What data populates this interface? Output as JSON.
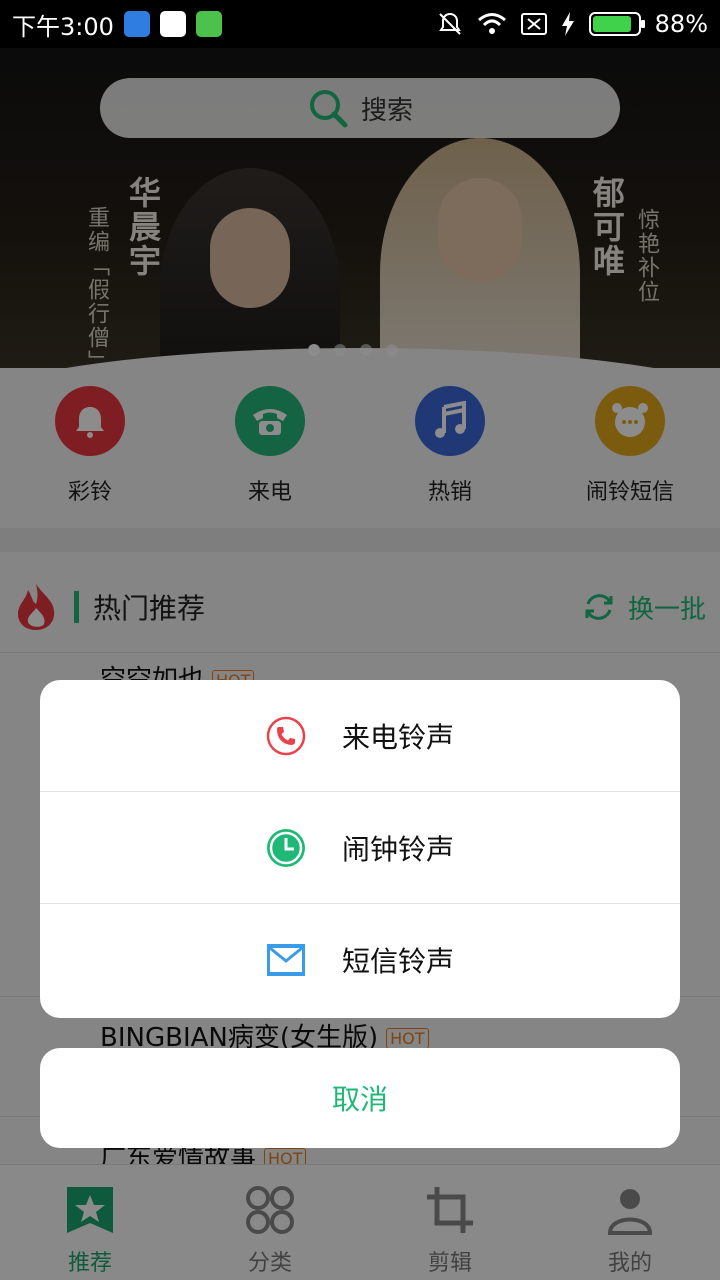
{
  "status_bar": {
    "time": "下午3:00",
    "battery": "88%",
    "battery_level": 0.88
  },
  "search": {
    "placeholder": "搜索"
  },
  "banner": {
    "artist_left": "华晨宇",
    "subtitle_left": "重编「假行僧」",
    "artist_right": "郁可唯",
    "subtitle_right": "惊艳补位",
    "active_dot": 1
  },
  "quick_actions": [
    {
      "label": "彩铃",
      "color": "#e8383f",
      "icon": "bell-icon"
    },
    {
      "label": "来电",
      "color": "#26b57a",
      "icon": "phone-icon"
    },
    {
      "label": "热销",
      "color": "#3b68d8",
      "icon": "music-note-icon"
    },
    {
      "label": "闹铃短信",
      "color": "#e0a81a",
      "icon": "alarm-chat-icon"
    }
  ],
  "section": {
    "title": "热门推荐",
    "refresh": "换一批"
  },
  "songs": [
    {
      "name": "空空如也",
      "badge": "HOT"
    },
    {
      "name": "BINGBIAN病变(女生版)",
      "badge": "HOT"
    },
    {
      "name": "广东爱情故事",
      "badge": "HOT"
    }
  ],
  "tabs": [
    {
      "label": "推荐",
      "active": true
    },
    {
      "label": "分类",
      "active": false
    },
    {
      "label": "剪辑",
      "active": false
    },
    {
      "label": "我的",
      "active": false
    }
  ],
  "sheet": {
    "options": [
      {
        "label": "来电铃声",
        "icon": "phone-ring-icon",
        "color": "#e8434b"
      },
      {
        "label": "闹钟铃声",
        "icon": "clock-icon",
        "color": "#1fb877"
      },
      {
        "label": "短信铃声",
        "icon": "mail-icon",
        "color": "#3a9be8"
      }
    ],
    "cancel": "取消"
  },
  "accent_color": "#1fb877"
}
